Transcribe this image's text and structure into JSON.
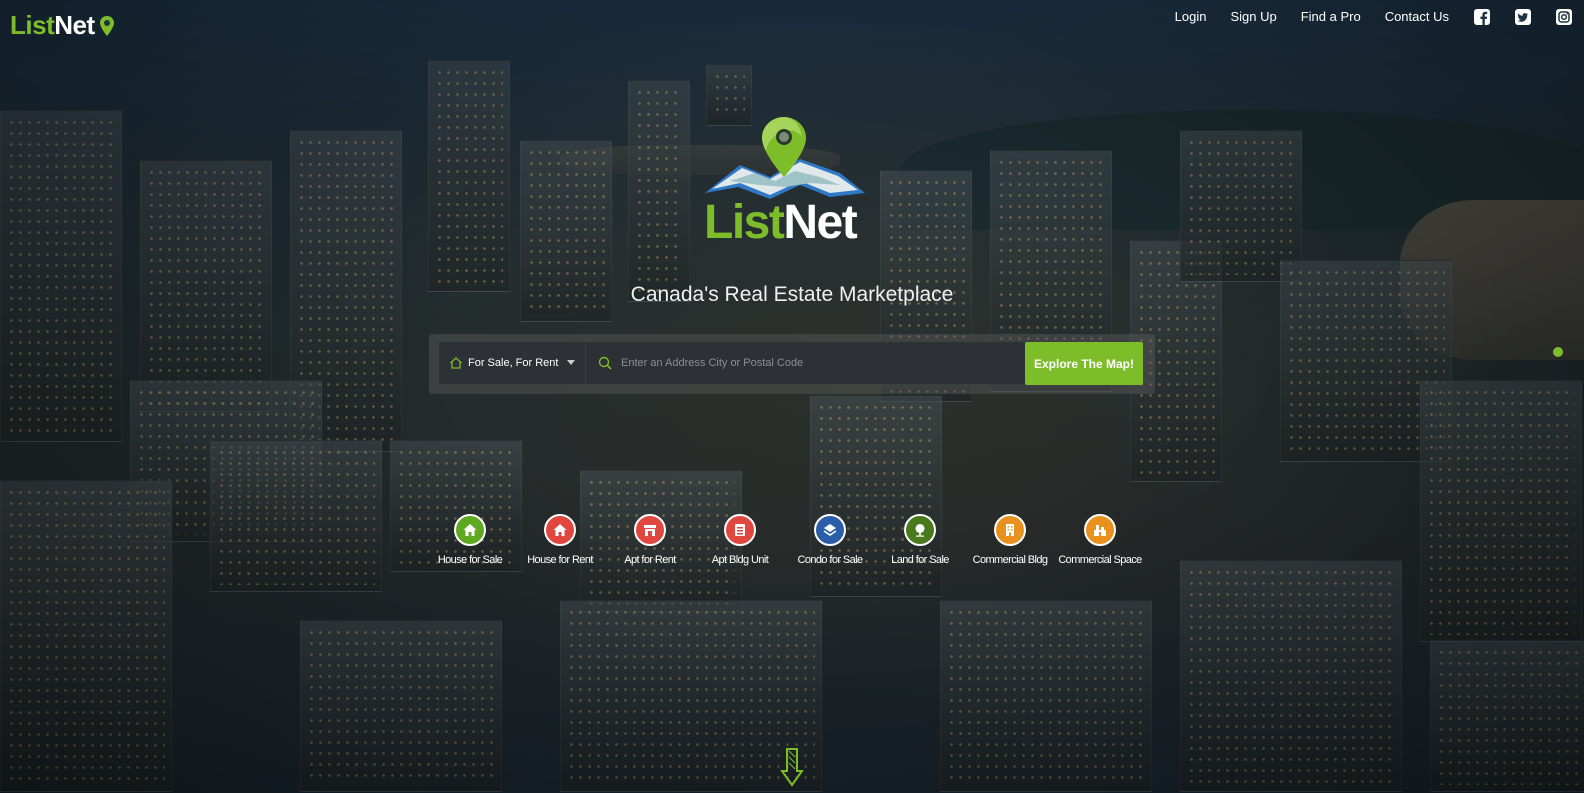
{
  "header": {
    "brand_green": "List",
    "brand_white": "Net",
    "nav": [
      {
        "label": "Login"
      },
      {
        "label": "Sign Up"
      },
      {
        "label": "Find a Pro"
      },
      {
        "label": "Contact Us"
      }
    ],
    "social": [
      "facebook-icon",
      "twitter-icon",
      "instagram-icon"
    ]
  },
  "hero": {
    "logo_green": "List",
    "logo_white": "Net",
    "tagline": "Canada's Real Estate Marketplace"
  },
  "search": {
    "type_value": "For Sale, For Rent",
    "placeholder": "Enter an Address City or Postal Code",
    "button_label": "Explore The Map!"
  },
  "categories": [
    {
      "label": "House for Sale",
      "color": "#5fa822",
      "icon": "house-icon"
    },
    {
      "label": "House for Rent",
      "color": "#e0473f",
      "icon": "house-icon"
    },
    {
      "label": "Apt for Rent",
      "color": "#e0473f",
      "icon": "storefront-icon"
    },
    {
      "label": "Apt Bldg Unit",
      "color": "#e0473f",
      "icon": "building-list-icon"
    },
    {
      "label": "Condo for Sale",
      "color": "#2a5ea8",
      "icon": "layers-icon"
    },
    {
      "label": "Land for Sale",
      "color": "#4b7a1d",
      "icon": "tree-icon"
    },
    {
      "label": "Commercial Bldg",
      "color": "#e8911f",
      "icon": "office-building-icon"
    },
    {
      "label": "Commercial Space",
      "color": "#e8911f",
      "icon": "commercial-space-icon"
    }
  ],
  "colors": {
    "accent": "#7dbd2a",
    "search_bg": "#2d3035"
  }
}
